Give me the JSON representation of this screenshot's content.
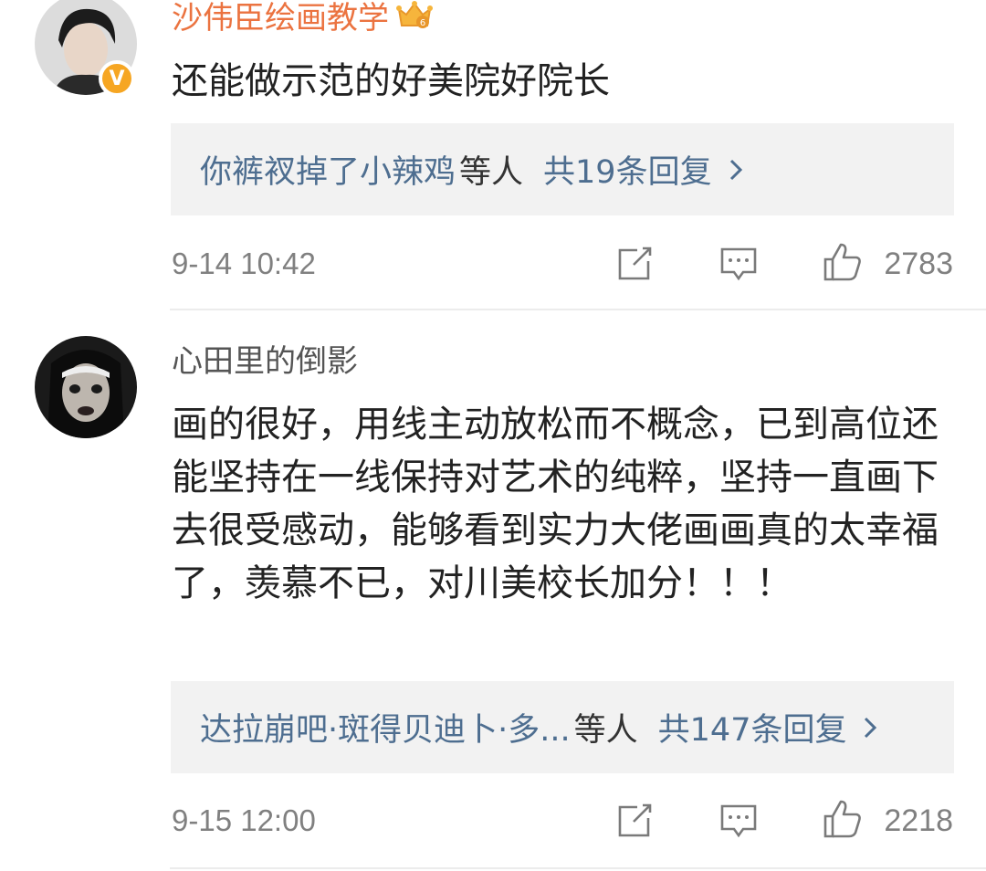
{
  "comments": [
    {
      "username": "沙伟臣绘画教学",
      "verified_badge": "V",
      "vip_icon": "crown-icon",
      "text": "还能做示范的好美院好院长",
      "replies_people": "你裤衩掉了小辣鸡",
      "replies_suffix": "等人",
      "replies_count": "共19条回复",
      "time": "9-14 10:42",
      "likes": "2783"
    },
    {
      "username": "心田里的倒影",
      "text": "画的很好，用线主动放松而不概念，已到高位还能坚持在一线保持对艺术的纯粹，坚持一直画下去很受感动，能够看到实力大佬画画真的太幸福了，羡慕不已，对川美校长加分！！！",
      "replies_people": "达拉崩吧·斑得贝迪卜·多...",
      "replies_suffix": "等人",
      "replies_count": "共147条回复",
      "time": "9-15 12:00",
      "likes": "2218"
    }
  ],
  "colors": {
    "vip_name": "#eb7340",
    "reply_link": "#4e6e90",
    "meta_gray": "#808080",
    "reply_bg": "#f2f2f2"
  }
}
